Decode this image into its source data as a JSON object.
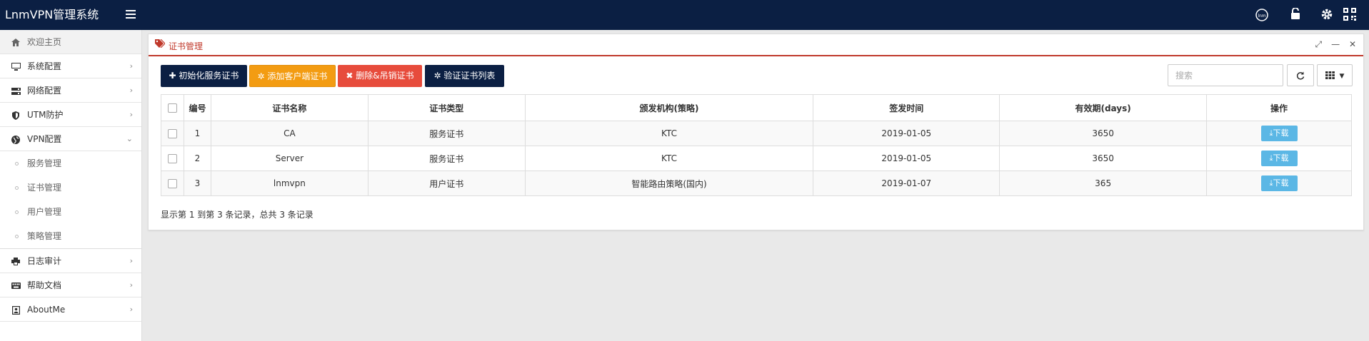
{
  "app": {
    "title": "LnmVPN管理系统"
  },
  "topbar": {
    "icons": [
      "lnm-logo-icon",
      "unlock-icon",
      "gear-icon",
      "qrcode-icon"
    ],
    "lnm_text": "lnm"
  },
  "sidebar": {
    "home": {
      "label": "欢迎主页",
      "icon": "home-icon"
    },
    "items": [
      {
        "label": "系统配置",
        "icon": "monitor-icon"
      },
      {
        "label": "网络配置",
        "icon": "server-icon"
      },
      {
        "label": "UTM防护",
        "icon": "shield-icon"
      },
      {
        "label": "VPN配置",
        "icon": "globe-icon"
      }
    ],
    "vpn_sub": [
      {
        "label": "服务管理"
      },
      {
        "label": "证书管理"
      },
      {
        "label": "用户管理"
      },
      {
        "label": "策略管理"
      }
    ],
    "bottom_items": [
      {
        "label": "日志审计",
        "icon": "print-icon"
      },
      {
        "label": "帮助文档",
        "icon": "keyboard-icon"
      },
      {
        "label": "AboutMe",
        "icon": "contact-icon"
      }
    ]
  },
  "panel": {
    "title": "证书管理"
  },
  "toolbar": {
    "init_label": "初始化服务证书",
    "add_label": "添加客户端证书",
    "delete_label": "删除&吊销证书",
    "verify_label": "验证证书列表"
  },
  "search": {
    "placeholder": "搜索"
  },
  "table": {
    "headers": [
      "编号",
      "证书名称",
      "证书类型",
      "颁发机构(策略)",
      "签发时间",
      "有效期(days)",
      "操作"
    ],
    "rows": [
      {
        "id": "1",
        "name": "CA",
        "type": "服务证书",
        "issuer": "KTC",
        "date": "2019-01-05",
        "validity": "3650",
        "action": "下载"
      },
      {
        "id": "2",
        "name": "Server",
        "type": "服务证书",
        "issuer": "KTC",
        "date": "2019-01-05",
        "validity": "3650",
        "action": "下载"
      },
      {
        "id": "3",
        "name": "lnmvpn",
        "type": "用户证书",
        "issuer": "智能路由策略(国内)",
        "date": "2019-01-07",
        "validity": "365",
        "action": "下载"
      }
    ]
  },
  "pagination": {
    "summary": "显示第 1 到第 3 条记录，总共 3 条记录"
  },
  "colors": {
    "navy": "#0b1f43",
    "orange": "#f39c12",
    "red": "#e74c3c",
    "download": "#5bb7e5",
    "accent": "#c0392b"
  }
}
